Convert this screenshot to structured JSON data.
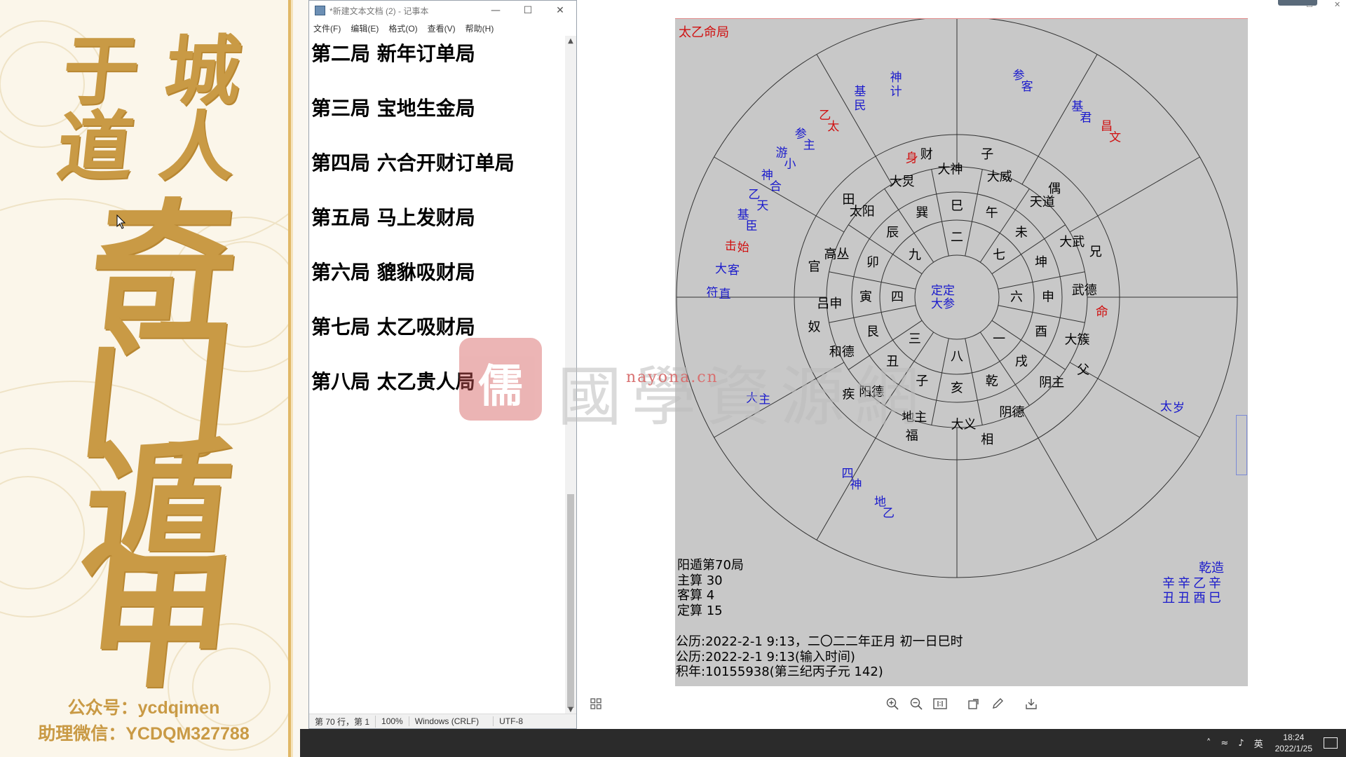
{
  "banner": {
    "title_line1": "于 城",
    "title_line2": "道 人",
    "big_chars": [
      "奇",
      "门",
      "遁",
      "甲"
    ],
    "wechat_public": "公众号：ycdqimen",
    "assistant_wechat": "助理微信：YCDQM327788",
    "gold_color": "#c99a45"
  },
  "notepad": {
    "title": "*新建文本文档 (2) - 记事本",
    "menu": [
      "文件(F)",
      "编辑(E)",
      "格式(O)",
      "查看(V)",
      "帮助(H)"
    ],
    "lines": [
      "第二局 新年订单局",
      "第三局 宝地生金局",
      "第四局 六合开财订单局",
      "第五局 马上发财局",
      "第六局 貔貅吸财局",
      "第七局 太乙吸财局",
      "第八局 太乙贵人局"
    ],
    "status": {
      "position": "第 70 行，第 1",
      "zoom": "100%",
      "line_ending": "Windows (CRLF)",
      "encoding": "UTF-8"
    }
  },
  "watermark": {
    "seal": "儒",
    "text": "國學資源網",
    "url": "nayona.cn"
  },
  "chart_data": {
    "type": "circular-diagram",
    "title": "太乙命局",
    "center": [
      "定定",
      "大参"
    ],
    "inner_numbers": [
      "二",
      "七",
      "六",
      "一",
      "八",
      "三",
      "四",
      "九"
    ],
    "branches": [
      "巳",
      "午",
      "未",
      "坤",
      "申",
      "酉",
      "戌",
      "乾",
      "亥",
      "子",
      "丑",
      "艮",
      "寅",
      "卯",
      "辰",
      "巽"
    ],
    "deities": [
      "大神",
      "大威",
      "天道",
      "大武",
      "武德",
      "大簇",
      "阴主",
      "阴德",
      "大义",
      "地主",
      "阳德",
      "和德",
      "吕申",
      "高丛",
      "太阳",
      "大炅"
    ],
    "palaces": [
      "财",
      "子",
      "偶",
      "兄",
      "命",
      "父",
      "相",
      "福",
      "疾",
      "奴",
      "官",
      "田",
      "身"
    ],
    "outer_labels": [
      {
        "text": "基民",
        "color": "blue"
      },
      {
        "text": "神计",
        "color": "blue"
      },
      {
        "text": "乙太",
        "color": "red"
      },
      {
        "text": "参主",
        "color": "blue"
      },
      {
        "text": "游小",
        "color": "blue"
      },
      {
        "text": "神合",
        "color": "blue"
      },
      {
        "text": "乙天",
        "color": "blue"
      },
      {
        "text": "基臣",
        "color": "blue"
      },
      {
        "text": "击始",
        "color": "red"
      },
      {
        "text": "大客",
        "color": "blue"
      },
      {
        "text": "符直",
        "color": "blue"
      },
      {
        "text": "参客",
        "color": "blue"
      },
      {
        "text": "基君",
        "color": "blue"
      },
      {
        "text": "昌文",
        "color": "red"
      },
      {
        "text": "太岁",
        "color": "blue"
      },
      {
        "text": "大主",
        "color": "blue"
      },
      {
        "text": "四神",
        "color": "blue"
      },
      {
        "text": "地乙",
        "color": "blue"
      }
    ],
    "info": {
      "ju": "阳遁第70局",
      "zhu_suan": "主算 30",
      "ke_suan": "客算 4",
      "ding_suan": "定算 15",
      "gregorian": "公历:2022-2-1 9:13，二〇二二年正月 初一日巳时",
      "input_time": "公历:2022-2-1 9:13(输入时间)",
      "ji_nian": "积年:10155938(第三纪丙子元 142)"
    },
    "bazi": {
      "label": "乾造",
      "stems": "辛辛乙辛",
      "branches": "丑丑酉巳"
    },
    "colors": {
      "blue": "#1a1acc",
      "red": "#d01010",
      "background": "#c8c8c8",
      "line": "#333333"
    }
  },
  "taskbar": {
    "ime": "英",
    "time": "18:24",
    "date": "2022/1/25"
  }
}
